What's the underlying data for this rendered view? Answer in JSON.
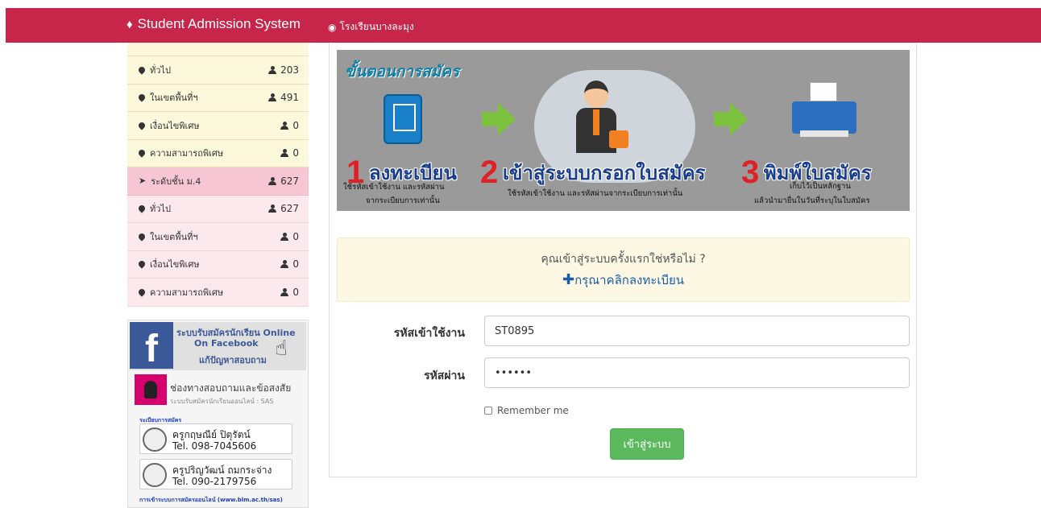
{
  "navbar": {
    "brand": "Student Admission System",
    "brand_icon": "fire-icon",
    "school_link": "โรงเรียนบางละมุง",
    "school_icon": "globe-icon",
    "color": "#c8254a"
  },
  "sidebar": {
    "rows": [
      {
        "label": "ทั่วไป",
        "count": "203"
      },
      {
        "label": "ในเขตพื้นที่ฯ",
        "count": "491"
      },
      {
        "label": "เงื่อนไขพิเศษ",
        "count": "0"
      },
      {
        "label": "ความสามารถพิเศษ",
        "count": "0"
      },
      {
        "label": "ระดับชั้น ม.4",
        "count": "627"
      },
      {
        "label": "ทั่วไป",
        "count": "627"
      },
      {
        "label": "ในเขตพื้นที่ฯ",
        "count": "0"
      },
      {
        "label": "เงื่อนไขพิเศษ",
        "count": "0"
      },
      {
        "label": "ความสามารถพิเศษ",
        "count": "0"
      }
    ]
  },
  "facebook": {
    "line1": "ระบบรับสมัครนักเรียน Online",
    "line2": "On Facebook",
    "line3": "แก้ปัญหาสอบถาม",
    "contact_title": "ช่องทางสอบถามและข้อสงสัย",
    "contact_sub": "ระบบรับสมัครนักเรียนออนไลน์ : SAS",
    "section1": "ระเบียบการสมัคร",
    "person1_name": "ครูกฤษณีย์   ปิตุรัตน์",
    "person1_phone": "Tel. 098-7045606",
    "person2_name": "ครูปริญวัฒน์ ถมกระจ่าง",
    "person2_phone": "Tel. 090-2179756",
    "section2": "การเข้าระบบการสมัครออนไลน์ (www.blm.ac.th/sas)"
  },
  "banner": {
    "title": "ขั้นตอนการสมัคร",
    "step1_num": "1",
    "step1_text": "ลงทะเบียน",
    "step1_cap1": "ใช้รหัสเข้าใช้งาน และรหัสผ่าน",
    "step1_cap2": "จากระเบียบการเท่านั้น",
    "step2_num": "2",
    "step2_text": "เข้าสู่ระบบกรอกใบสมัคร",
    "step2_cap": "ใช้รหัสเข้าใช้งาน และรหัสผ่านจากระเบียบการเท่านั้น",
    "step3_num": "3",
    "step3_text": "พิมพ์ใบสมัคร",
    "step3_cap1": "เก็บไว้เป็นหลักฐาน",
    "step3_cap2": "แล้วนำมายื่นในวันที่ระบุในใบสมัคร"
  },
  "alert": {
    "question": "คุณเข้าสู่ระบบครั้งแรกใช่หรือไม่ ?",
    "register_link": "กรุณาคลิกลงทะเบียน",
    "plus": "✚"
  },
  "form": {
    "username_label": "รหัสเข้าใช้งาน",
    "username_value": "ST0895",
    "password_label": "รหัสผ่าน",
    "password_value": "••••••",
    "remember_label": "Remember me",
    "submit_label": "เข้าสู่ระบบ"
  }
}
